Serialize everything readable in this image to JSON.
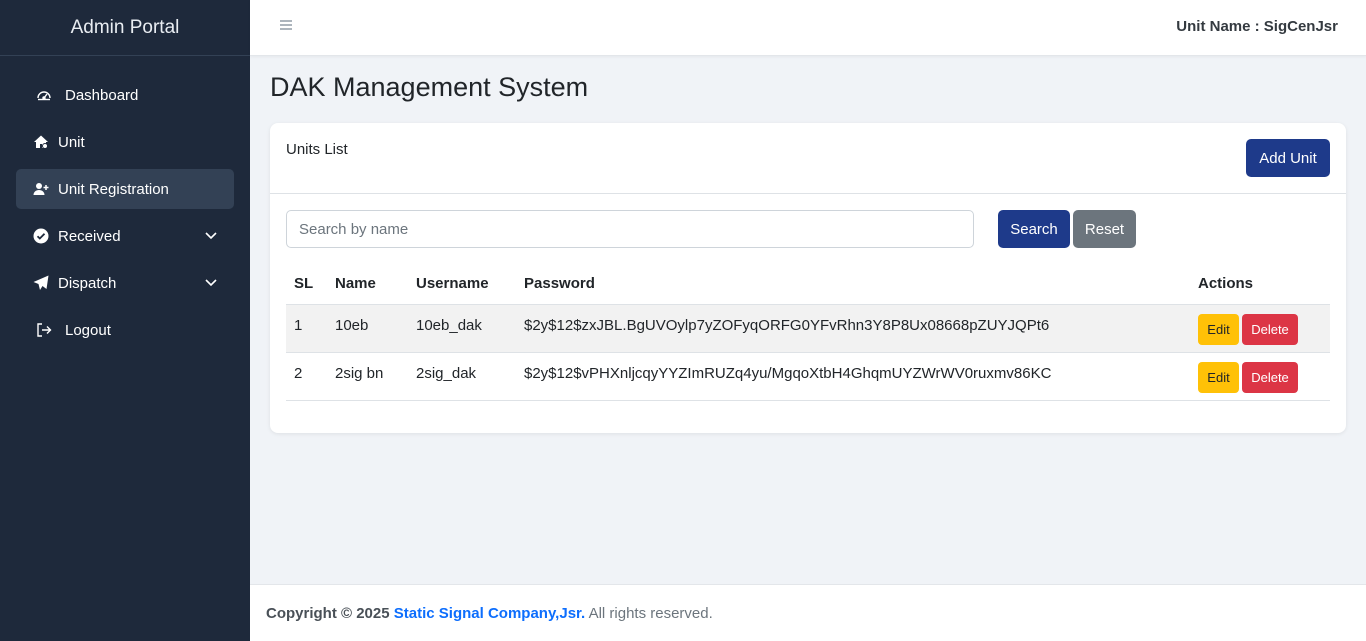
{
  "sidebar": {
    "brand": "Admin Portal",
    "items": [
      {
        "label": "Dashboard",
        "icon": "dashboard-gauge-icon"
      },
      {
        "label": "Unit",
        "icon": "home-icon"
      },
      {
        "label": "Unit Registration",
        "icon": "user-plus-icon",
        "active": true
      },
      {
        "label": "Received",
        "icon": "check-circle-icon",
        "expandable": true
      },
      {
        "label": "Dispatch",
        "icon": "paper-plane-icon",
        "expandable": true
      },
      {
        "label": "Logout",
        "icon": "logout-icon"
      }
    ]
  },
  "topbar": {
    "unit_name": "Unit Name : SigCenJsr"
  },
  "page": {
    "title": "DAK Management System"
  },
  "card": {
    "title": "Units List",
    "add_button": "Add Unit",
    "search": {
      "placeholder": "Search by name",
      "value": "",
      "search_label": "Search",
      "reset_label": "Reset"
    },
    "table": {
      "headers": [
        "SL",
        "Name",
        "Username",
        "Password",
        "Actions"
      ],
      "rows": [
        {
          "sl": "1",
          "name": "10eb",
          "username": "10eb_dak",
          "password": "$2y$12$zxJBL.BgUVOylp7yZOFyqORFG0YFvRhn3Y8P8Ux08668pZUYJQPt6",
          "edit": "Edit",
          "delete": "Delete"
        },
        {
          "sl": "2",
          "name": "2sig bn",
          "username": "2sig_dak",
          "password": "$2y$12$vPHXnljcqyYYZImRUZq4yu/MgqoXtbH4GhqmUYZWrWV0ruxmv86KC",
          "edit": "Edit",
          "delete": "Delete"
        }
      ]
    }
  },
  "footer": {
    "prefix": "Copyright © 2025",
    "company": "Static Signal Company,Jsr.",
    "suffix": "All rights reserved."
  },
  "colors": {
    "sidebar_bg": "#1e293b",
    "sidebar_active": "#334155",
    "primary": "#1e3a8a",
    "secondary": "#6c757d",
    "warning": "#ffc107",
    "danger": "#dc3545",
    "link": "#0d6efd"
  }
}
